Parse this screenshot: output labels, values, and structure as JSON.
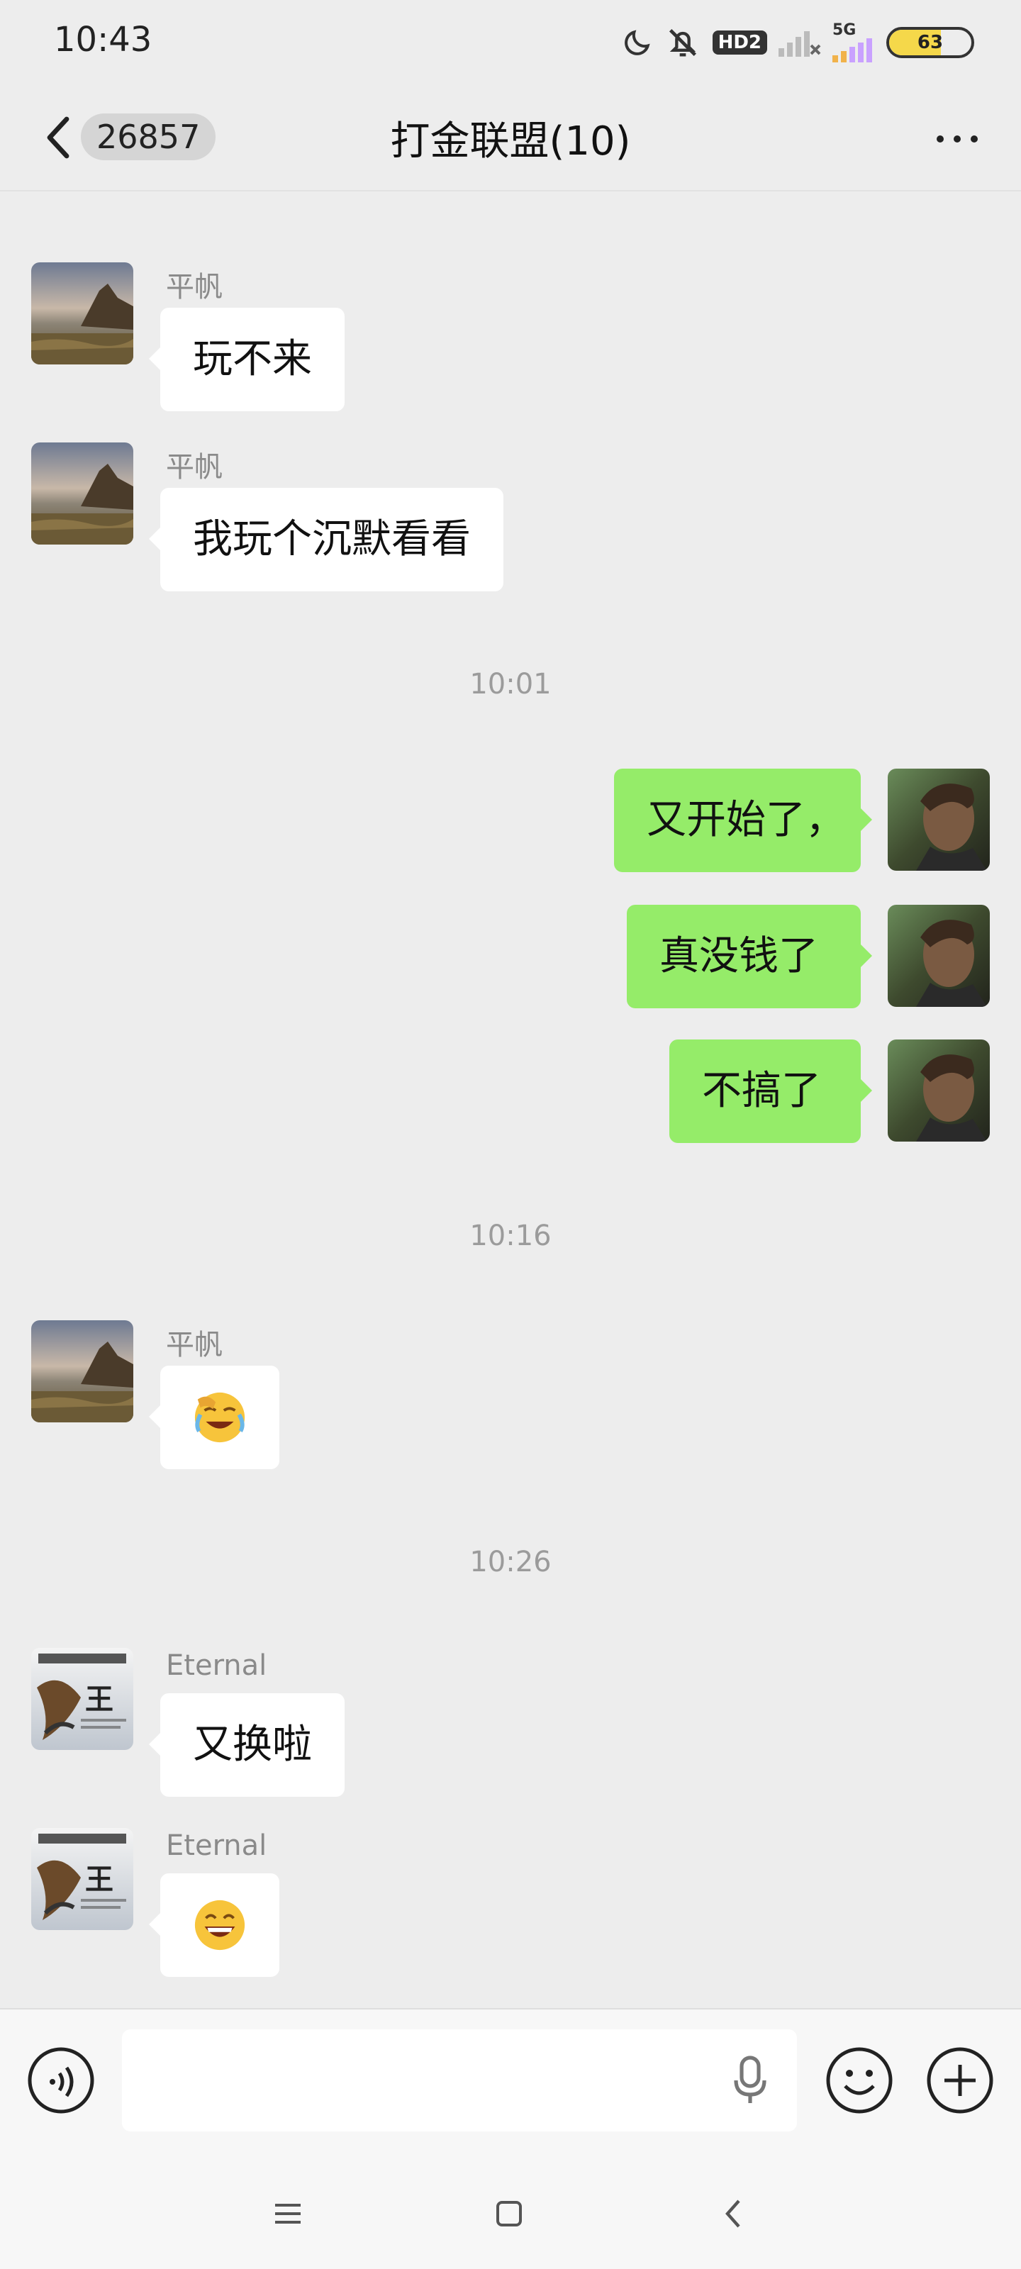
{
  "status": {
    "time": "10:43",
    "hd": "HD2",
    "net": "5G",
    "battery": "63",
    "battery_level": 0.63
  },
  "header": {
    "back_badge": "26857",
    "title": "打金联盟(10)"
  },
  "messages": [
    {
      "sender": "平帆",
      "text": "玩不来"
    },
    {
      "sender": "平帆",
      "text": "我玩个沉默看看"
    },
    {
      "timestamp": "10:01"
    },
    {
      "text": "又开始了，"
    },
    {
      "text": "真没钱了"
    },
    {
      "text": "不搞了"
    },
    {
      "timestamp": "10:16"
    },
    {
      "sender": "平帆",
      "emoji": "facepalm-laughing-emoji"
    },
    {
      "timestamp": "10:26"
    },
    {
      "sender": "Eternal",
      "text": "又换啦"
    },
    {
      "sender": "Eternal",
      "emoji": "grinning-emoji"
    }
  ],
  "avatar_logo": {
    "text": "王"
  },
  "input": {
    "placeholder": ""
  },
  "colors": {
    "self_bubble": "#95ec69",
    "other_bubble": "#ffffff",
    "background": "#ededed"
  }
}
